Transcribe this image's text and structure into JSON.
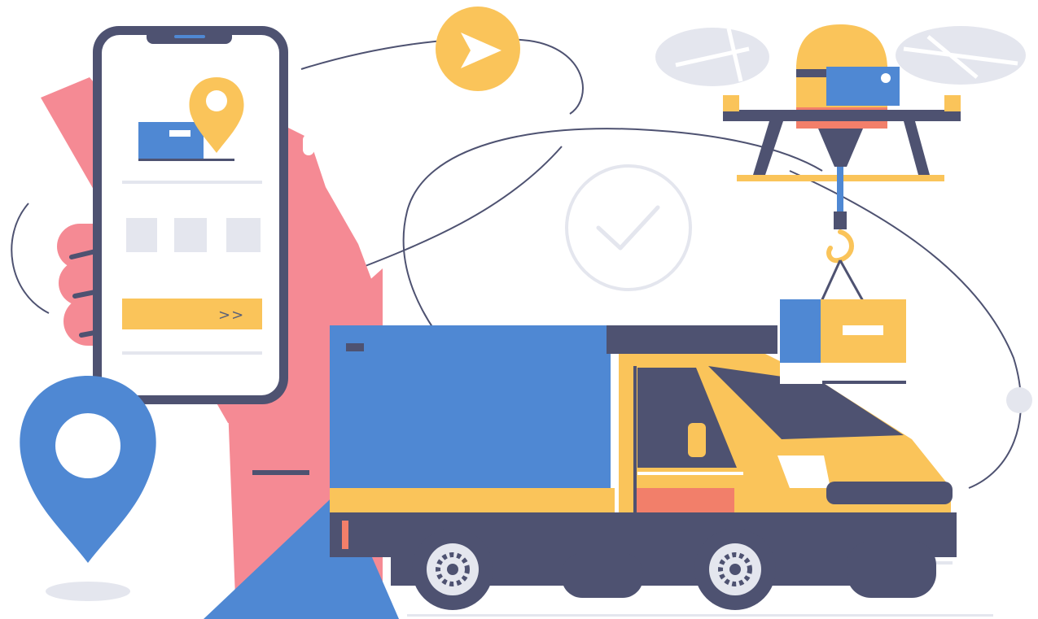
{
  "illustration": {
    "phone_button_label": ">>"
  },
  "colors": {
    "navy": "#4e5271",
    "blue": "#4f88d3",
    "yellow": "#fac45a",
    "pink": "#f58a94",
    "coral": "#f27f6a",
    "light_gray": "#e4e6ee",
    "line": "#4e5271"
  },
  "icons": {
    "phone": "smartphone-icon",
    "location": "map-pin-icon",
    "send": "send-arrow-icon",
    "check": "checkmark-circle-icon",
    "drone": "delivery-drone-icon",
    "truck": "delivery-truck-icon",
    "package": "package-box-icon"
  }
}
